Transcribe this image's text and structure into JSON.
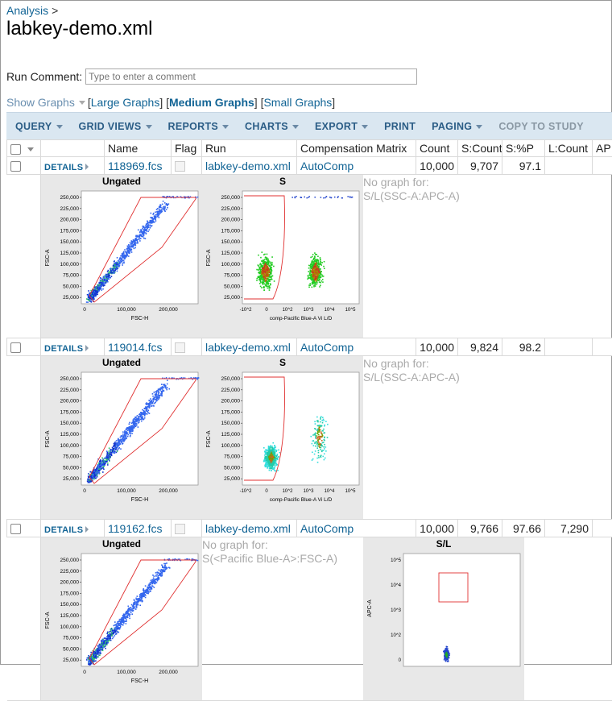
{
  "breadcrumb": {
    "link": "Analysis",
    "sep": ">"
  },
  "title": "labkey-demo.xml",
  "comment": {
    "label": "Run Comment:",
    "placeholder": "Type to enter a comment"
  },
  "graphs": {
    "show": "Show Graphs",
    "large": "Large Graphs",
    "medium": "Medium Graphs",
    "small": "Small Graphs"
  },
  "toolbar": {
    "query": "QUERY",
    "grid_views": "GRID VIEWS",
    "reports": "REPORTS",
    "charts": "CHARTS",
    "export": "EXPORT",
    "print": "PRINT",
    "paging": "PAGING",
    "copy": "COPY TO STUDY"
  },
  "columns": [
    "Name",
    "Flag",
    "Run",
    "Compensation Matrix",
    "Count",
    "S:Count",
    "S:%P",
    "L:Count",
    "AP"
  ],
  "details_label": "DETAILS",
  "rows": [
    {
      "name": "118969.fcs",
      "run": "labkey-demo.xml",
      "comp": "AutoComp",
      "count": "10,000",
      "s_count": "9,707",
      "s_p": "97.1",
      "l_count": ""
    },
    {
      "name": "119014.fcs",
      "run": "labkey-demo.xml",
      "comp": "AutoComp",
      "count": "10,000",
      "s_count": "9,824",
      "s_p": "98.2",
      "l_count": ""
    },
    {
      "name": "119162.fcs",
      "run": "labkey-demo.xml",
      "comp": "AutoComp",
      "count": "10,000",
      "s_count": "9,766",
      "s_p": "97.66",
      "l_count": "7,290"
    }
  ],
  "plots": {
    "ungated_title": "Ungated",
    "s_title": "S",
    "sl_title": "S/L",
    "fsc_ticks": [
      "250,000",
      "225,000",
      "200,000",
      "175,000",
      "150,000",
      "125,000",
      "100,000",
      "75,000",
      "50,000",
      "25,000"
    ],
    "fsch_ticks": [
      "0",
      "100,000",
      "200,000"
    ],
    "comp_ticks": [
      "-10^2",
      "0",
      "10^2",
      "10^3",
      "10^4",
      "10^5"
    ],
    "fsca": "FSC-A",
    "fsch": "FSC-H",
    "comp_label": "comp-Pacific Blue-A Vi L/D",
    "apca": "APC-A",
    "apc_ticks": [
      "10^5",
      "10^4",
      "10^3",
      "10^2",
      "0"
    ],
    "nograph_prefix": "No graph for:",
    "nograph_sl": "S/L(SSC-A:APC-A)",
    "nograph_s": "S(<Pacific Blue-A>:FSC-A)"
  },
  "colors": {
    "link": "#126495",
    "toolbar_bg": "#dae7f1",
    "toolbar_text": "#2b5d86",
    "gate": "#e03030"
  }
}
